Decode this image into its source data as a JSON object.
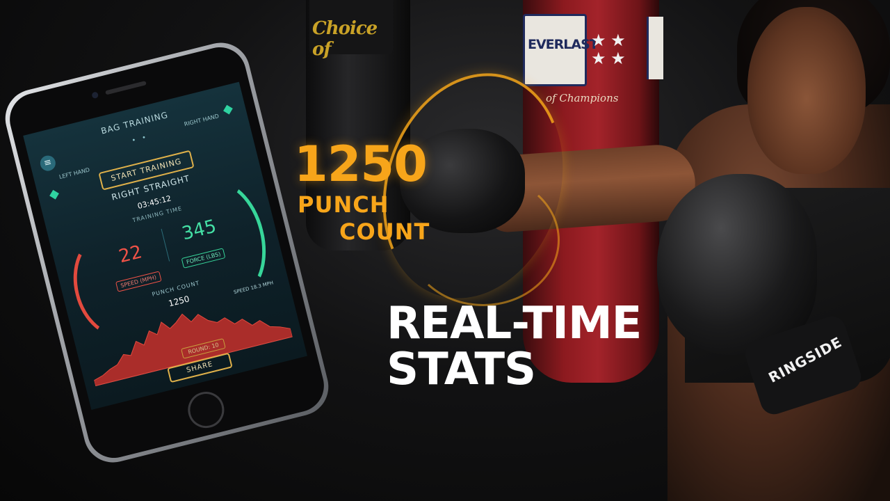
{
  "overlay": {
    "punch_count_value": "1250",
    "punch_label_line1": "PUNCH",
    "punch_label_line2": "COUNT",
    "headline_line1": "REAL-TIME",
    "headline_line2": "STATS",
    "accent_color": "#f7a51a"
  },
  "scene": {
    "bag_black_brand": "Choice of",
    "bag_red_brand": "EVERLAST",
    "bag_red_tagline": "of Champions",
    "glove_brand": "RINGSIDE"
  },
  "app": {
    "title": "BAG TRAINING",
    "menu_icon": "menu-icon",
    "left_hand_label": "LEFT HAND",
    "right_hand_label": "RIGHT HAND",
    "start_button_label": "START TRAINING",
    "mode": "RIGHT STRAIGHT",
    "training_time_value": "03:45:12",
    "training_time_label": "TRAINING TIME",
    "speed_value": "22",
    "speed_label": "SPEED (MPH)",
    "force_value": "345",
    "force_label": "FORCE (LBS)",
    "punch_count_label": "PUNCH COUNT",
    "punch_count_value": "1250",
    "speed_note": "SPEED 18.3 MPH",
    "round_label": "ROUND: 10",
    "share_button_label": "SHARE",
    "colors": {
      "speed": "#ef5247",
      "force": "#44e0a5",
      "button_border": "#e0b14a"
    }
  }
}
